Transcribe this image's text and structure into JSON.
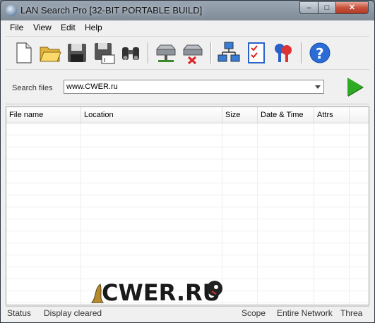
{
  "window": {
    "title": "LAN Search Pro [32-BIT PORTABLE BUILD]"
  },
  "menu": {
    "items": [
      "File",
      "View",
      "Edit",
      "Help"
    ]
  },
  "toolbar": {
    "icons": [
      "new-document-icon",
      "open-folder-icon",
      "save-disk-icon",
      "save-as-disk-icon",
      "binoculars-icon",
      "map-network-drive-icon",
      "disconnect-network-drive-icon",
      "network-computers-icon",
      "checklist-icon",
      "keys-icon",
      "help-icon"
    ]
  },
  "search": {
    "label": "Search files",
    "value": "www.CWER.ru"
  },
  "table": {
    "columns": [
      "File name",
      "Location",
      "Size",
      "Date & Time",
      "Attrs"
    ]
  },
  "watermark": {
    "text": "CWER.RU"
  },
  "status": {
    "label": "Status",
    "message": "Display cleared",
    "scope_label": "Scope",
    "scope_value": "Entire Network",
    "threads_label": "Threa"
  },
  "colors": {
    "go_button": "#2eaa25",
    "title_gradient_top": "#9aa6b2",
    "close_button": "#c7513c"
  }
}
